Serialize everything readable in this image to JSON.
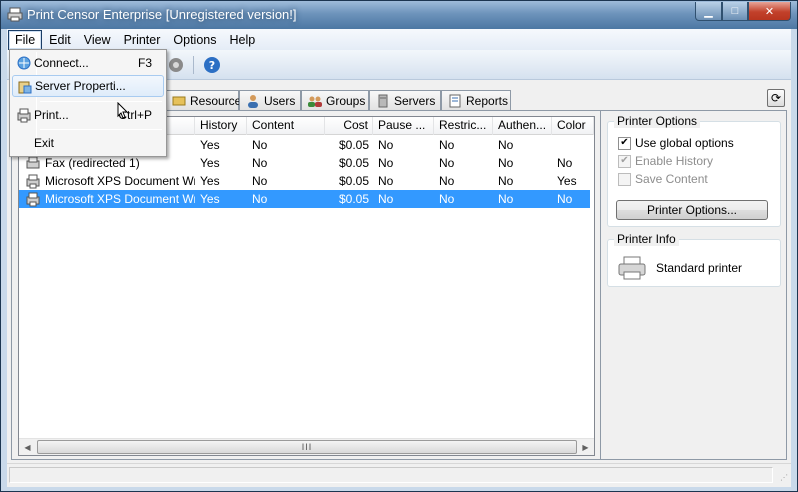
{
  "window": {
    "title": "Print Censor Enterprise [Unregistered version!]",
    "minimize_glyph": "▁",
    "maximize_glyph": "□",
    "close_glyph": "✕"
  },
  "menubar": {
    "items": [
      "File",
      "Edit",
      "View",
      "Printer",
      "Options",
      "Help"
    ]
  },
  "file_menu": {
    "items": [
      {
        "label": "Connect...",
        "shortcut": "F3",
        "icon": "connect-icon"
      },
      {
        "label": "Server Properti...",
        "shortcut": "",
        "icon": "server-properties-icon"
      },
      {
        "label": "Print...",
        "shortcut": "Ctrl+P",
        "icon": "print-icon"
      },
      {
        "label": "Exit",
        "shortcut": "",
        "icon": ""
      }
    ]
  },
  "tabs": [
    {
      "label": "Resources",
      "icon": "resources-icon"
    },
    {
      "label": "Users",
      "icon": "user-icon"
    },
    {
      "label": "Groups",
      "icon": "groups-icon"
    },
    {
      "label": "Servers",
      "icon": "server-icon"
    },
    {
      "label": "Reports",
      "icon": "report-icon"
    }
  ],
  "refresh_glyph": "⟳",
  "table": {
    "columns": [
      "History",
      "Content",
      "Cost",
      "Pause ...",
      "Restric...",
      "Authen...",
      "Color"
    ],
    "rows": [
      {
        "name": "",
        "history": "Yes",
        "content": "No",
        "cost": "$0.05",
        "pause": "No",
        "restrict": "No",
        "authen": "No",
        "color": ""
      },
      {
        "name": "Fax (redirected 1)",
        "history": "Yes",
        "content": "No",
        "cost": "$0.05",
        "pause": "No",
        "restrict": "No",
        "authen": "No",
        "color": "No"
      },
      {
        "name": "Microsoft XPS Document Wr...",
        "history": "Yes",
        "content": "No",
        "cost": "$0.05",
        "pause": "No",
        "restrict": "No",
        "authen": "No",
        "color": "Yes"
      },
      {
        "name": "Microsoft XPS Document Wr...",
        "history": "Yes",
        "content": "No",
        "cost": "$0.05",
        "pause": "No",
        "restrict": "No",
        "authen": "No",
        "color": "No",
        "selected": true
      }
    ],
    "scroll_grip": "III",
    "scroll_left": "◀",
    "scroll_right": "▶"
  },
  "printer_options": {
    "title": "Printer Options",
    "use_global": {
      "label": "Use global options",
      "checked": true
    },
    "enable_history": {
      "label": "Enable History",
      "checked": true,
      "disabled": true
    },
    "save_content": {
      "label": "Save Content",
      "checked": false,
      "disabled": true
    },
    "button_label": "Printer Options..."
  },
  "printer_info": {
    "title": "Printer Info",
    "type_label": "Standard printer"
  },
  "colors": {
    "selection": "#3399ff",
    "titlebar": "#4c77a3"
  }
}
